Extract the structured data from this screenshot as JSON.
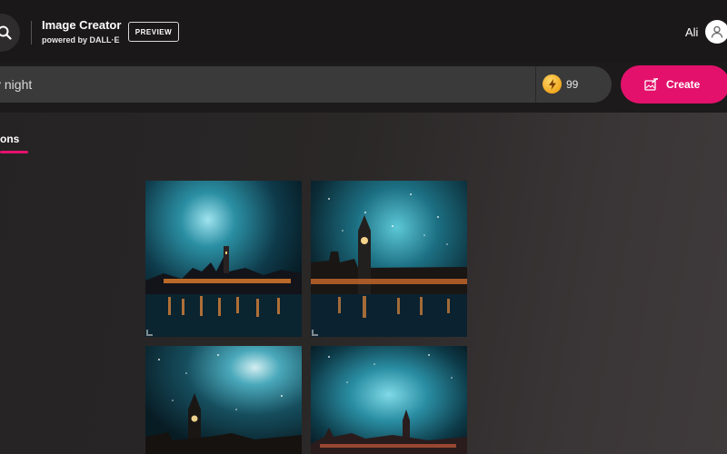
{
  "header": {
    "title": "Image Creator",
    "subtitle": "powered by DALL·E",
    "badge": "PREVIEW",
    "user_name": "Ali",
    "icons": {
      "search": "search-icon",
      "avatar": "user-avatar-icon"
    }
  },
  "search": {
    "value": "y night",
    "coin_count": "99",
    "coin_icon": "lightning-coin-icon",
    "create_label": "Create",
    "create_icon": "image-create-icon"
  },
  "tabs": {
    "creations_label": "ations"
  },
  "colors": {
    "accent": "#e3116c",
    "header_bg": "#1a1818",
    "search_bg": "#3b3a3a"
  },
  "results": {
    "images": [
      {
        "alt": "London skyline at starry night"
      },
      {
        "alt": "Big Ben under starry night sky"
      },
      {
        "alt": "Big Ben with glowing galaxy sky"
      },
      {
        "alt": "London skyline with teal aurora sky"
      }
    ]
  }
}
